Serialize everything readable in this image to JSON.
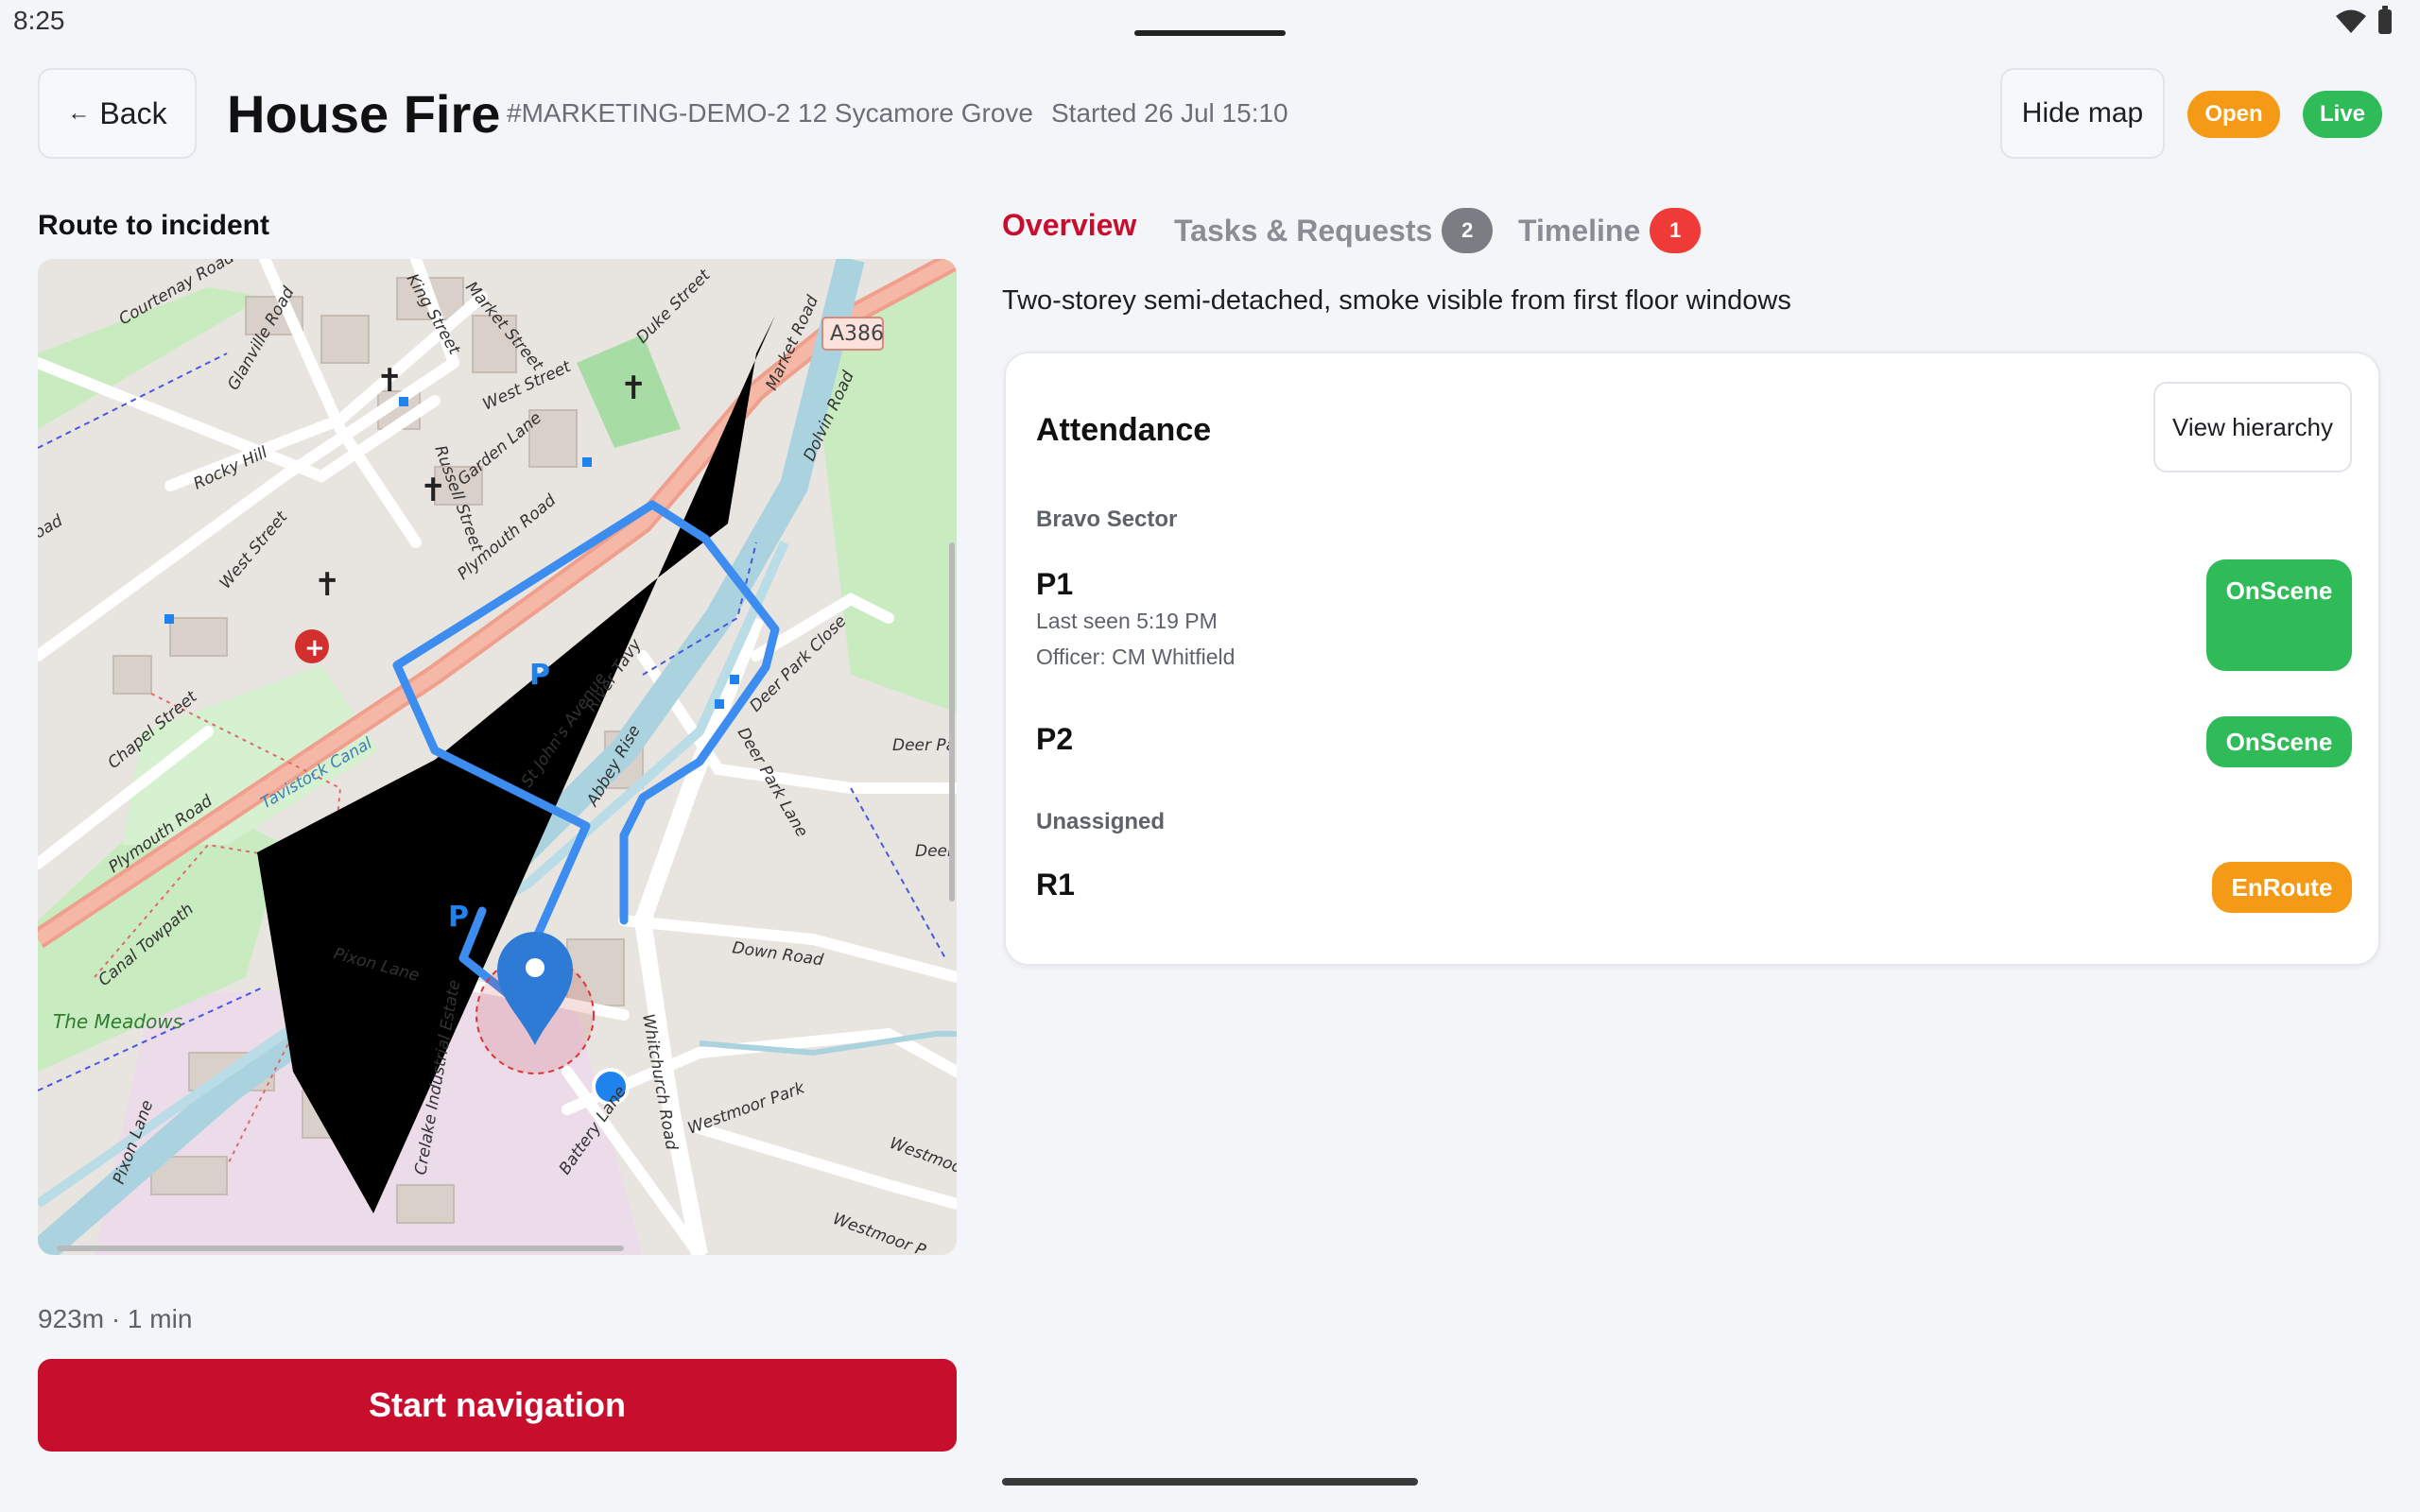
{
  "status_bar": {
    "time": "8:25"
  },
  "header": {
    "back_label": "Back",
    "back_arrow": "←",
    "title": "House Fire",
    "incident_id": "#MARKETING-DEMO-2",
    "address": "12 Sycamore Grove",
    "started": "Started 26 Jul 15:10",
    "hide_map_label": "Hide map",
    "badges": {
      "open": "Open",
      "live": "Live"
    }
  },
  "route": {
    "section_title": "Route to incident",
    "summary": "923m · 1 min",
    "start_button": "Start navigation"
  },
  "map": {
    "road_a386": "A386",
    "labels": {
      "courtenay": "Courtenay Road",
      "glanville": "Glanville Road",
      "king": "King Street",
      "market": "Market Street",
      "duke": "Duke Street",
      "market_road": "Market Road",
      "dolvin": "Dolvin Road",
      "west": "West Street",
      "rocky": "Rocky Hill",
      "west2": "West Street",
      "russell": "Russell Street",
      "garden": "Garden Lane",
      "plymouth": "Plymouth Road",
      "plymouth2": "Plymouth Road",
      "river": "River Tavy",
      "st_johns": "St John's Avenue",
      "abbey": "Abbey Rise",
      "deer_close": "Deer Park Close",
      "deer_lane": "Deer Park Lane",
      "deer_pa": "Deer Pa",
      "deer": "Deer",
      "chapel": "Chapel Street",
      "canal": "Tavistock Canal",
      "towpath": "Canal Towpath",
      "meadows": "The Meadows",
      "pixon": "Pixon Lane",
      "pixon2": "Pixon Lane",
      "down": "Down Road",
      "whitchurch": "Whitchurch Road",
      "westmoor": "Westmoor Park",
      "westmoor2": "Westmoo",
      "westmoor3": "Westmoor P",
      "battery": "Battery Lane",
      "crelake": "Crelake Industrial Estate",
      "road": "oad"
    },
    "colors": {
      "route": "#3d8cf0",
      "primary_road": "#f09f8c",
      "water": "#aad3df",
      "park": "#c8ecc0",
      "industrial": "#ecdcea"
    }
  },
  "tabs": [
    {
      "label": "Overview",
      "badge": ""
    },
    {
      "label": "Tasks & Requests",
      "badge": "2"
    },
    {
      "label": "Timeline",
      "badge": "1"
    }
  ],
  "description": "Two-storey semi-detached, smoke visible from first floor windows",
  "attendance": {
    "title": "Attendance",
    "view_hierarchy": "View hierarchy",
    "groups": [
      {
        "label": "Bravo Sector",
        "units": [
          {
            "name": "P1",
            "last_seen": "Last seen 5:19 PM",
            "officer": "Officer: CM Whitfield",
            "status": "OnScene"
          },
          {
            "name": "P2",
            "status": "OnScene"
          }
        ]
      },
      {
        "label": "Unassigned",
        "units": [
          {
            "name": "R1",
            "status": "EnRoute"
          }
        ]
      }
    ],
    "status_colors": {
      "OnScene": "#2fbb57",
      "EnRoute": "#f59a16"
    }
  }
}
